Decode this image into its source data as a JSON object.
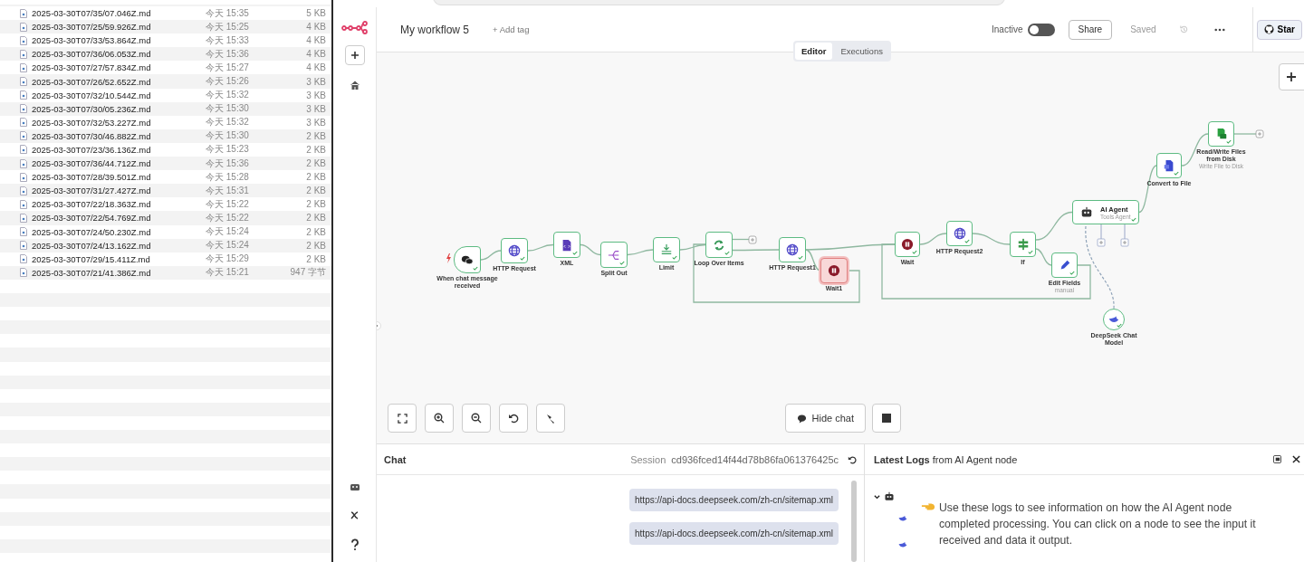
{
  "file_list": {
    "files": [
      {
        "name": "2025-03-30T07/35/07.046Z.md",
        "modified": "今天 15:35",
        "size": "5 KB"
      },
      {
        "name": "2025-03-30T07/25/59.926Z.md",
        "modified": "今天 15:25",
        "size": "4 KB"
      },
      {
        "name": "2025-03-30T07/33/53.864Z.md",
        "modified": "今天 15:33",
        "size": "4 KB"
      },
      {
        "name": "2025-03-30T07/36/06.053Z.md",
        "modified": "今天 15:36",
        "size": "4 KB"
      },
      {
        "name": "2025-03-30T07/27/57.834Z.md",
        "modified": "今天 15:27",
        "size": "4 KB"
      },
      {
        "name": "2025-03-30T07/26/52.652Z.md",
        "modified": "今天 15:26",
        "size": "3 KB"
      },
      {
        "name": "2025-03-30T07/32/10.544Z.md",
        "modified": "今天 15:32",
        "size": "3 KB"
      },
      {
        "name": "2025-03-30T07/30/05.236Z.md",
        "modified": "今天 15:30",
        "size": "3 KB"
      },
      {
        "name": "2025-03-30T07/32/53.227Z.md",
        "modified": "今天 15:32",
        "size": "3 KB"
      },
      {
        "name": "2025-03-30T07/30/46.882Z.md",
        "modified": "今天 15:30",
        "size": "2 KB"
      },
      {
        "name": "2025-03-30T07/23/36.136Z.md",
        "modified": "今天 15:23",
        "size": "2 KB"
      },
      {
        "name": "2025-03-30T07/36/44.712Z.md",
        "modified": "今天 15:36",
        "size": "2 KB"
      },
      {
        "name": "2025-03-30T07/28/39.501Z.md",
        "modified": "今天 15:28",
        "size": "2 KB"
      },
      {
        "name": "2025-03-30T07/31/27.427Z.md",
        "modified": "今天 15:31",
        "size": "2 KB"
      },
      {
        "name": "2025-03-30T07/22/18.363Z.md",
        "modified": "今天 15:22",
        "size": "2 KB"
      },
      {
        "name": "2025-03-30T07/22/54.769Z.md",
        "modified": "今天 15:22",
        "size": "2 KB"
      },
      {
        "name": "2025-03-30T07/24/50.230Z.md",
        "modified": "今天 15:24",
        "size": "2 KB"
      },
      {
        "name": "2025-03-30T07/24/13.162Z.md",
        "modified": "今天 15:24",
        "size": "2 KB"
      },
      {
        "name": "2025-03-30T07/29/15.411Z.md",
        "modified": "今天 15:29",
        "size": "2 KB"
      },
      {
        "name": "2025-03-30T07/21/41.386Z.md",
        "modified": "今天 15:21",
        "size": "947 字节"
      }
    ]
  },
  "header": {
    "workflow_name": "My workflow 5",
    "add_tag": "+ Add tag",
    "active": false,
    "active_label": "Inactive",
    "share": "Share",
    "save_status": "Saved",
    "star": "Star"
  },
  "view_tabs": [
    {
      "label": "Editor",
      "selected": true
    },
    {
      "label": "Executions",
      "selected": false
    }
  ],
  "canvas": {
    "nodes": [
      {
        "kind": "trigger",
        "label": "When chat message received",
        "succeeded": true,
        "running": false
      },
      {
        "kind": "action",
        "label": "HTTP Request",
        "succeeded": true,
        "running": false
      },
      {
        "kind": "action",
        "label": "XML",
        "succeeded": true,
        "running": false
      },
      {
        "kind": "action",
        "label": "Split Out",
        "succeeded": true,
        "running": false
      },
      {
        "kind": "action",
        "label": "Limit",
        "succeeded": true,
        "running": false
      },
      {
        "kind": "action",
        "label": "Loop Over Items",
        "succeeded": true,
        "running": false
      },
      {
        "kind": "action",
        "label": "HTTP Request1",
        "succeeded": true,
        "running": false
      },
      {
        "kind": "action",
        "label": "Wait1",
        "succeeded": false,
        "running": true
      },
      {
        "kind": "action",
        "label": "Wait",
        "succeeded": true,
        "running": false
      },
      {
        "kind": "action",
        "label": "HTTP Request2",
        "succeeded": true,
        "running": false
      },
      {
        "kind": "action",
        "label": "If",
        "succeeded": true,
        "running": false
      },
      {
        "kind": "action",
        "label": "Edit Fields",
        "subtitle": "manual",
        "succeeded": true,
        "running": false
      },
      {
        "kind": "agent",
        "label": "AI Agent",
        "subtitle": "Tools Agent",
        "succeeded": true,
        "running": false
      },
      {
        "kind": "sub",
        "label": "DeepSeek Chat Model",
        "succeeded": true,
        "running": false
      },
      {
        "kind": "action",
        "label": "Convert to File",
        "succeeded": true,
        "running": false
      },
      {
        "kind": "action",
        "label": "Read/Write Files from Disk",
        "subtitle": "Write File to Disk",
        "succeeded": true,
        "running": false
      }
    ]
  },
  "canvas_toolbar": {
    "hide_chat": "Hide chat"
  },
  "chat": {
    "title": "Chat",
    "session_label": "Session",
    "session_id": "cd936fced14f44d78b86fa061376425c",
    "messages": [
      "https://api-docs.deepseek.com/zh-cn/sitemap.xml",
      "https://api-docs.deepseek.com/zh-cn/sitemap.xml"
    ]
  },
  "logs": {
    "title": "**Latest Logs** from AI Agent node",
    "tree_expanded": true,
    "hint": "Use these logs to see information on how the AI Agent node completed processing. You can click on a node to see the input it received and data it output."
  }
}
